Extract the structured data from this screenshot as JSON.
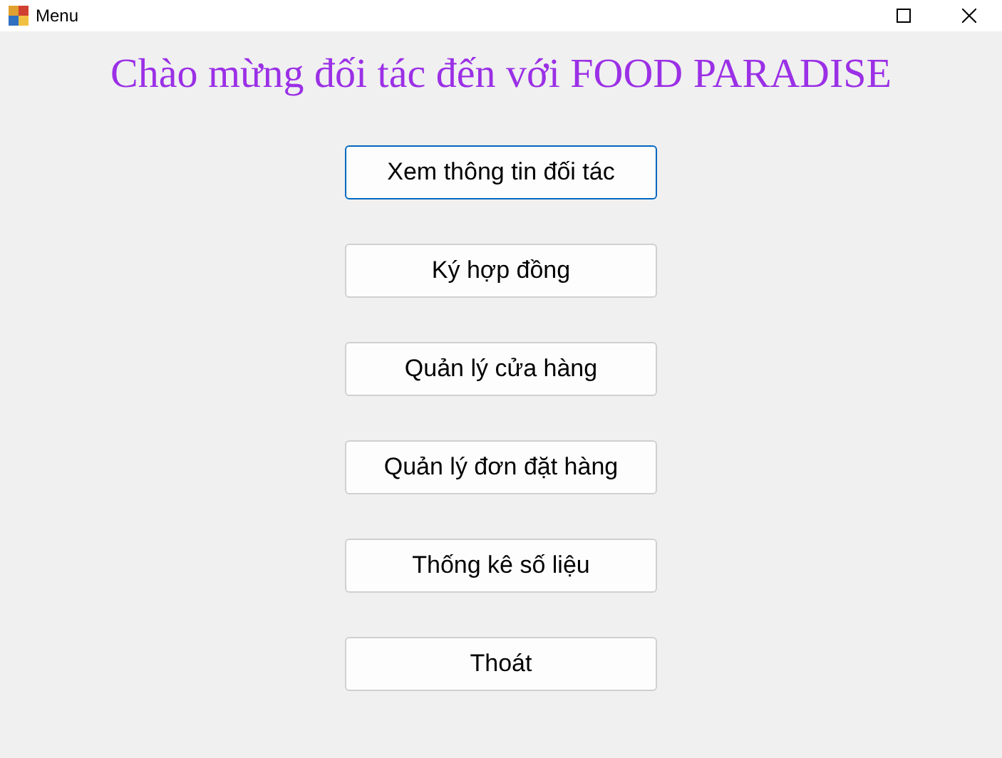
{
  "window": {
    "title": "Menu"
  },
  "heading": "Chào mừng đối tác đến với FOOD PARADISE",
  "buttons": [
    {
      "label": "Xem thông tin đối tác",
      "focused": true
    },
    {
      "label": "Ký hợp đồng",
      "focused": false
    },
    {
      "label": "Quản lý cửa hàng",
      "focused": false
    },
    {
      "label": "Quản lý đơn đặt hàng",
      "focused": false
    },
    {
      "label": "Thống kê số liệu",
      "focused": false
    },
    {
      "label": "Thoát",
      "focused": false
    }
  ]
}
